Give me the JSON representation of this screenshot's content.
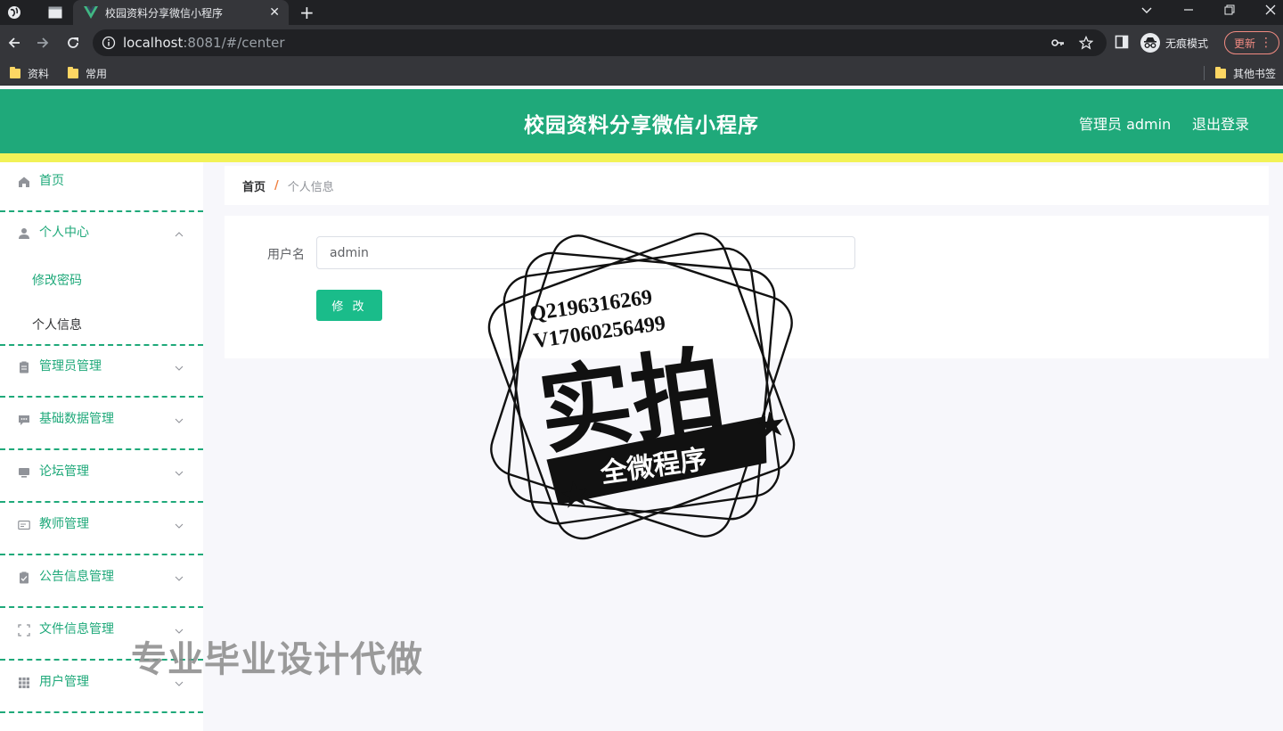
{
  "browser": {
    "tab_title": "校园资料分享微信小程序",
    "tab_close": "✕",
    "new_tab": "+",
    "url_host": "localhost",
    "url_rest": ":8081/#/center",
    "incognito_label": "无痕模式",
    "update_label": "更新",
    "bookmarks": [
      "资料",
      "常用"
    ],
    "other_bookmarks": "其他书签",
    "icons": [
      "globe-icon",
      "tab-strip-icon",
      "vue-logo-icon",
      "back-arrow-icon",
      "forward-arrow-icon",
      "reload-icon",
      "info-icon",
      "key-icon",
      "star-icon",
      "side-panel-icon",
      "incognito-icon",
      "more-icon",
      "minimize-icon",
      "restore-icon",
      "close-icon",
      "chevron-down-icon"
    ]
  },
  "header": {
    "title": "校园资料分享微信小程序",
    "user_label": "管理员 admin",
    "logout_label": "退出登录"
  },
  "sidebar": {
    "items": [
      {
        "label": "首页",
        "icon": "home-icon"
      },
      {
        "label": "个人中心",
        "icon": "user-icon",
        "expanded": true,
        "children": [
          {
            "label": "修改密码",
            "active": false
          },
          {
            "label": "个人信息",
            "active": true
          }
        ]
      },
      {
        "label": "管理员管理",
        "icon": "clipboard-icon"
      },
      {
        "label": "基础数据管理",
        "icon": "chat-icon"
      },
      {
        "label": "论坛管理",
        "icon": "monitor-icon"
      },
      {
        "label": "教师管理",
        "icon": "id-card-icon"
      },
      {
        "label": "公告信息管理",
        "icon": "clipboard-check-icon"
      },
      {
        "label": "文件信息管理",
        "icon": "frame-icon"
      },
      {
        "label": "用户管理",
        "icon": "grid-icon"
      }
    ]
  },
  "breadcrumb": {
    "home": "首页",
    "separator": "/",
    "current": "个人信息"
  },
  "form": {
    "username_label": "用户名",
    "username_value": "admin",
    "submit_label": "修 改"
  },
  "overlay": {
    "stamp_line1": "Q2196316269",
    "stamp_line2": "V17060256499",
    "stamp_big": "实拍",
    "stamp_banner": "全微程序",
    "watermark": "专业毕业设计代做"
  },
  "colors": {
    "accent": "#1fa97a",
    "highlight_bar": "#f2f257",
    "button": "#1abc8a",
    "breadcrumb_separator": "#f08040"
  }
}
